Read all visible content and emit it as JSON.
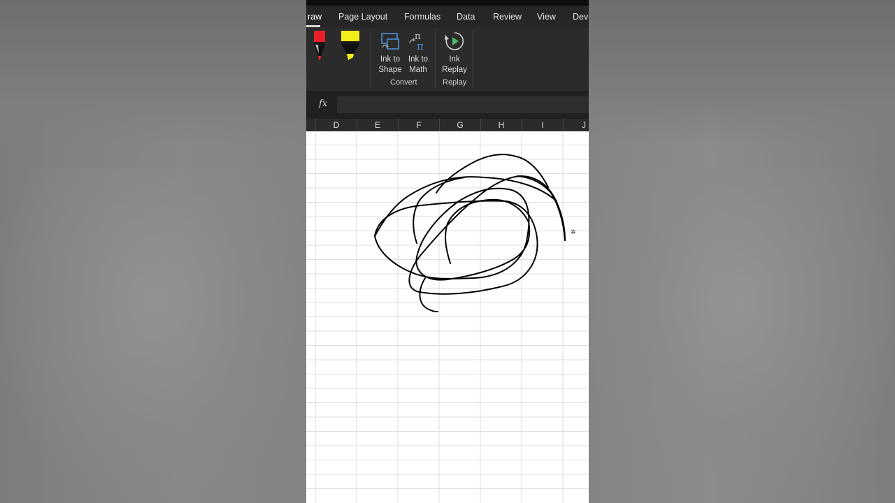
{
  "ribbon_tabs": [
    {
      "label": "raw",
      "active": true
    },
    {
      "label": "Page Layout"
    },
    {
      "label": "Formulas"
    },
    {
      "label": "Data"
    },
    {
      "label": "Review"
    },
    {
      "label": "View"
    },
    {
      "label": "Deve"
    }
  ],
  "pens": [
    {
      "name": "red pen",
      "color": "#e8202a",
      "icon": "pen-icon"
    },
    {
      "name": "yellow highlighter",
      "color": "#f2ee1c",
      "icon": "highlighter-icon"
    }
  ],
  "convert": {
    "ink_to_shape_label": [
      "Ink to",
      "Shape"
    ],
    "ink_to_math_label": [
      "Ink to",
      "Math"
    ],
    "group_label": "Convert"
  },
  "replay": {
    "ink_replay_label": [
      "Ink",
      "Replay"
    ],
    "group_label": "Replay"
  },
  "formula_bar": {
    "fx_label": "fx",
    "value": ""
  },
  "columns": [
    "D",
    "E",
    "F",
    "G",
    "H",
    "I",
    "J"
  ],
  "colors": {
    "ribbon": "#2b2b2b",
    "tabs": "#262626",
    "grid": "#d9d9d9",
    "ink": "#000000",
    "accent_green": "#4fb870",
    "accent_blue": "#4a90d9"
  }
}
